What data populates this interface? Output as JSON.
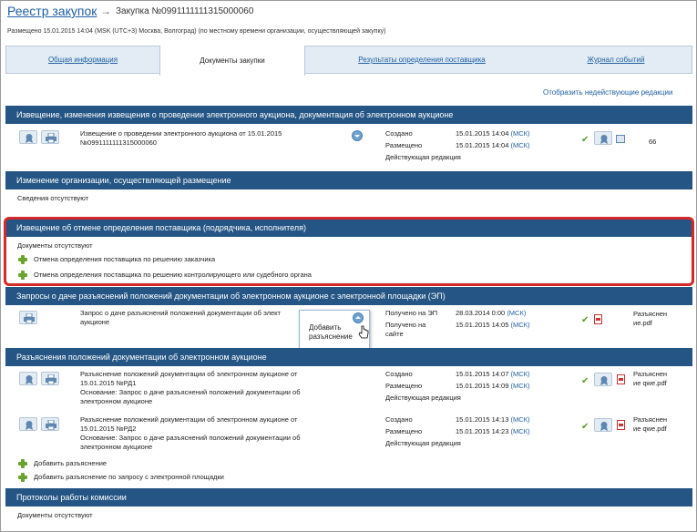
{
  "header": {
    "breadcrumb_main": "Реестр закупок",
    "breadcrumb_sep": "→",
    "procurement_title": "Закупка №0991111111315000060",
    "placed_info": "Размещено 15.01.2015 14:04 (MSK (UTC+3) Москва, Волгоград) (по местному времени организации, осуществляющей закупку)"
  },
  "tabs": [
    {
      "label": "Общая информация"
    },
    {
      "label": "Документы закупки"
    },
    {
      "label": "Результаты определения поставщика"
    },
    {
      "label": "Журнал событий"
    }
  ],
  "show_inactive_link": "Отобразить недействующие редакции",
  "sec1": {
    "title": "Извещение, изменения извещения о проведении электронного аукциона, документация об электронном аукционе",
    "row": {
      "desc_line1": "Извещение о проведении электронного аукциона от 15.01.2015",
      "desc_line2": "№0991111111315000060",
      "created_label": "Создано",
      "created_date": "15.01.2015 14:04",
      "created_tz": "(МСК)",
      "placed_label": "Размещено",
      "placed_date": "15.01.2015 14:04",
      "placed_tz": "(МСК)",
      "edition": "Действующая редакция",
      "count": "66"
    }
  },
  "sec2": {
    "title": "Изменение организации, осуществляющей размещение",
    "empty": "Сведения отсутствуют"
  },
  "sec3": {
    "title": "Извещение об отмене определения поставщика (подрядчика, исполнителя)",
    "empty": "Документы отсутствуют",
    "link1": "Отмена определения поставщика по решению заказчика",
    "link2": "Отмена определения поставщика по решению контролирующего или судебного органа"
  },
  "sec4": {
    "title": "Запросы о даче разъяснений положений документации об электронном аукционе с электронной площадки (ЭП)",
    "row": {
      "desc_line1": "Запрос о даче разъяснений положений документации об элект",
      "desc_line2": "аукционе",
      "received_ep_label": "Получено на ЭП",
      "received_ep_date": "28.03.2014 0:00",
      "received_ep_tz": "(МСК)",
      "received_site_label1": "Получено на",
      "received_site_label2": "сайте",
      "received_site_date": "15.01.2015 14:05",
      "received_site_tz": "(МСК)",
      "file_line1": "Разъяснен",
      "file_line2": "ие.pdf"
    },
    "popup_line1": "Добавить",
    "popup_line2": "разъяснение"
  },
  "sec5": {
    "title": "Разъяснения положений документации об электронном аукционе",
    "rows": [
      {
        "l1": "Разъяснение положений документации об электронном аукционе от",
        "l2": "15.01.2015 №РД1",
        "l3": "Основание: Запрос о даче разъяснений положений документации об",
        "l4": "электронном аукционе",
        "created_label": "Создано",
        "created_date": "15.01.2015 14:07",
        "created_tz": "(МСК)",
        "placed_label": "Размещено",
        "placed_date": "15.01.2015 14:09",
        "placed_tz": "(МСК)",
        "edition": "Действующая редакция",
        "file_line1": "Разъяснен",
        "file_line2": "ие qwe.pdf"
      },
      {
        "l1": "Разъяснение положений документации об электронном аукционе от",
        "l2": "15.01.2015 №РД2",
        "l3": "Основание: Запрос о даче разъяснений положений документации об",
        "l4": "электронном аукционе",
        "created_label": "Создано",
        "created_date": "15.01.2015 14:13",
        "created_tz": "(МСК)",
        "placed_label": "Размещено",
        "placed_date": "15.01.2015 14:23",
        "placed_tz": "(МСК)",
        "edition": "Действующая редакция",
        "file_line1": "Разъяснен",
        "file_line2": "ие qwe.pdf"
      }
    ],
    "add_link1": "Добавить разъяснение",
    "add_link2": "Добавить разъяснение по запросу с электронной площадки"
  },
  "sec6": {
    "title": "Протоколы работы комиссии",
    "empty": "Документы отсутствуют"
  },
  "colors": {
    "header_bar": "#245584",
    "link": "#1f5fa0",
    "highlight": "#d42a2a",
    "check": "#5c9a2c"
  }
}
